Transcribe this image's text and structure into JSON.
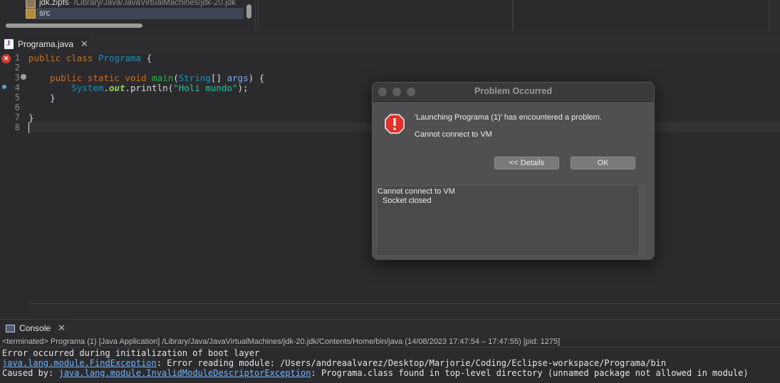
{
  "package_explorer": {
    "jar_label": "jdk.zipfs",
    "jar_path": " - /Library/Java/JavaVirtualMachines/jdk-20.jdk",
    "src_label": "src"
  },
  "editor": {
    "tab_label": "Programa.java",
    "lines": [
      {
        "no": "1"
      },
      {
        "no": "2"
      },
      {
        "no": "3"
      },
      {
        "no": "4"
      },
      {
        "no": "5"
      },
      {
        "no": "6"
      },
      {
        "no": "7"
      },
      {
        "no": "8"
      }
    ],
    "code": {
      "l1_kw1": "public",
      "l1_kw2": "class",
      "l1_cls": "Programa",
      "l1_brace": " {",
      "l3_kw1": "public",
      "l3_kw2": "static",
      "l3_kw3": "void",
      "l3_fn": "main",
      "l3_open": "(",
      "l3_type": "String",
      "l3_arr": "[] ",
      "l3_param": "args",
      "l3_close": ") {",
      "l4_sys": "System",
      "l4_dot1": ".",
      "l4_out": "out",
      "l4_dot2": ".println(",
      "l4_str": "\"Holi mundo\"",
      "l4_end": ");",
      "l5": "}",
      "l7": "}"
    }
  },
  "dialog": {
    "title": "Problem Occurred",
    "message": "'Launching Programa (1)' has encountered a problem.",
    "submessage": "Cannot connect to VM",
    "details_button": "<< Details",
    "ok_button": "OK",
    "details_line1": "Cannot connect to VM",
    "details_line2": "Socket closed"
  },
  "console": {
    "tab_label": "Console",
    "status": "<terminated> Programa (1) [Java Application] /Library/Java/JavaVirtualMachines/jdk-20.jdk/Contents/Home/bin/java  (14/08/2023 17:47:54 – 17:47:55) [pid: 1275]",
    "line1": "Error occurred during initialization of boot layer",
    "line2_link": "java.lang.module.FindException",
    "line2_rest": ": Error reading module: /Users/andreaalvarez/Desktop/Marjorie/Coding/Eclipse-workspace/Programa/bin",
    "line3_prefix": "Caused by: ",
    "line3_link": "java.lang.module.InvalidModuleDescriptorException",
    "line3_rest": ": Programa.class found in top-level directory (unnamed package not allowed in module)"
  },
  "colors": {
    "keyword": "#cc6c1d",
    "class_name": "#1290c3",
    "method": "#1eb540",
    "string": "#17c6a3",
    "link": "#6fb3ff",
    "error": "#d8362f"
  }
}
